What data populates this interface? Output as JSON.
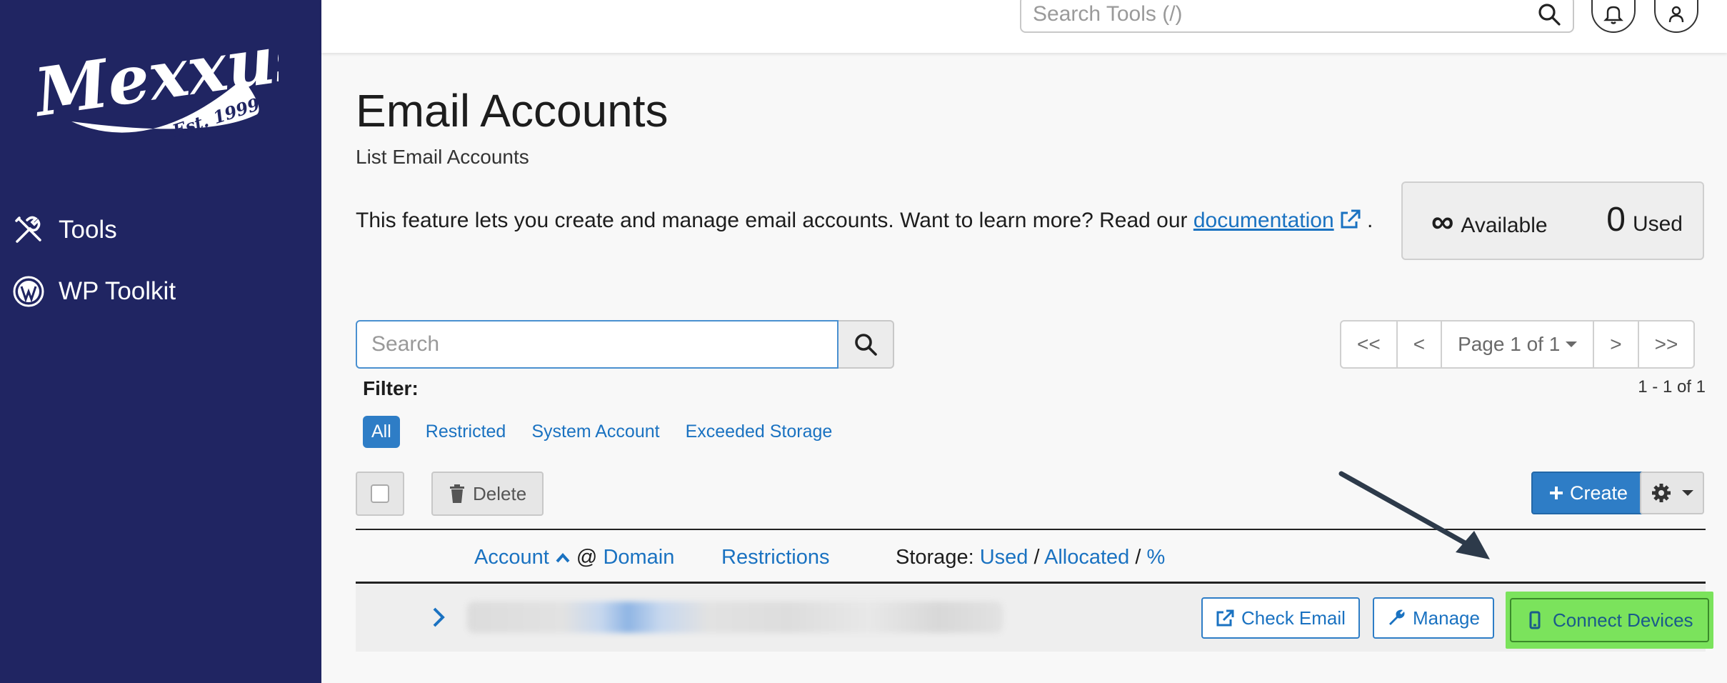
{
  "sidebar": {
    "logo_text": "Mexxus",
    "logo_sub": "Est. 1999",
    "items": [
      {
        "label": "Tools",
        "icon": "tools-icon"
      },
      {
        "label": "WP Toolkit",
        "icon": "wordpress-icon"
      }
    ]
  },
  "header": {
    "search_placeholder": "Search Tools (/)"
  },
  "page": {
    "title": "Email Accounts",
    "subtitle": "List Email Accounts",
    "description_prefix": "This feature lets you create and manage email accounts. Want to learn more? Read our ",
    "description_link": "documentation",
    "description_suffix": " ."
  },
  "stats": {
    "available_value": "∞",
    "available_label": "Available",
    "used_value": "0",
    "used_label": "Used"
  },
  "search": {
    "placeholder": "Search"
  },
  "pagination": {
    "first": "<<",
    "prev": "<",
    "page_label": "Page 1 of 1",
    "next": ">",
    "last": ">>",
    "count": "1 - 1 of 1"
  },
  "filter": {
    "label": "Filter:",
    "options": [
      "All",
      "Restricted",
      "System Account",
      "Exceeded Storage"
    ],
    "selected": "All"
  },
  "toolbar": {
    "delete_label": "Delete",
    "create_label": "Create"
  },
  "table": {
    "col_account": "Account",
    "col_at": "@",
    "col_domain": "Domain",
    "col_restrictions": "Restrictions",
    "col_storage_prefix": "Storage:",
    "col_used": "Used",
    "col_allocated": "Allocated",
    "col_percent": "%",
    "sep": "/",
    "row_actions": {
      "check_email": "Check Email",
      "manage": "Manage",
      "connect_devices": "Connect Devices"
    }
  },
  "colors": {
    "sidebar_bg": "#202562",
    "accent": "#2e7dc6",
    "highlight": "#7be35c"
  }
}
